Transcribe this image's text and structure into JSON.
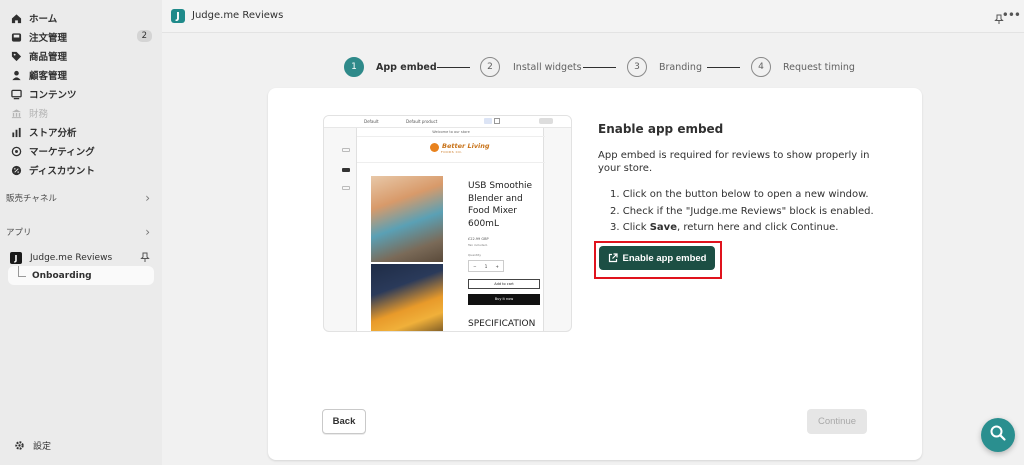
{
  "sidebar": {
    "items": [
      {
        "label": "ホーム",
        "icon": "home-icon"
      },
      {
        "label": "注文管理",
        "icon": "inbox-icon",
        "badge": "2"
      },
      {
        "label": "商品管理",
        "icon": "tag-icon"
      },
      {
        "label": "顧客管理",
        "icon": "person-icon"
      },
      {
        "label": "コンテンツ",
        "icon": "content-icon"
      },
      {
        "label": "財務",
        "icon": "bank-icon"
      },
      {
        "label": "ストア分析",
        "icon": "bar-chart-icon"
      },
      {
        "label": "マーケティング",
        "icon": "target-icon"
      },
      {
        "label": "ディスカウント",
        "icon": "discount-icon"
      }
    ],
    "sales_channels": "販売チャネル",
    "apps": "アプリ",
    "app_name": "Judge.me Reviews",
    "app_sub": "Onboarding",
    "settings": "設定"
  },
  "topbar": {
    "logo": "J",
    "title": "Judge.me Reviews"
  },
  "stepper": [
    {
      "num": "1",
      "label": "App embed"
    },
    {
      "num": "2",
      "label": "Install widgets"
    },
    {
      "num": "3",
      "label": "Branding"
    },
    {
      "num": "4",
      "label": "Request timing"
    }
  ],
  "preview": {
    "toolbar_left": "Default",
    "toolbar_mid": "Default product",
    "welcome": "Welcome to our store",
    "brand": "Better Living",
    "brand_sub": "FOODS CO.",
    "product_title": "USB Smoothie Blender and Food Mixer 600mL",
    "price": "£22.99 GBP",
    "tax": "Tax included.",
    "qty_label": "Quantity",
    "qty_minus": "−",
    "qty_value": "1",
    "qty_plus": "+",
    "add_to_cart": "Add to cart",
    "buy_now": "Buy it now",
    "spec": "SPECIFICATION"
  },
  "main": {
    "title": "Enable app embed",
    "description": "App embed is required for reviews to show properly in your store.",
    "step1": "1. Click on the button below to open a new window.",
    "step2": "2. Check if the \"Judge.me Reviews\" block is enabled.",
    "step3_prefix": "3. Click ",
    "step3_bold": "Save",
    "step3_suffix": ", return here and click Continue.",
    "enable_button": "Enable app embed",
    "back_button": "Back",
    "continue_button": "Continue"
  },
  "colors": {
    "accent_teal": "#2f8a8a",
    "primary_button": "#1c4f44",
    "highlight_red": "#e0131d"
  }
}
